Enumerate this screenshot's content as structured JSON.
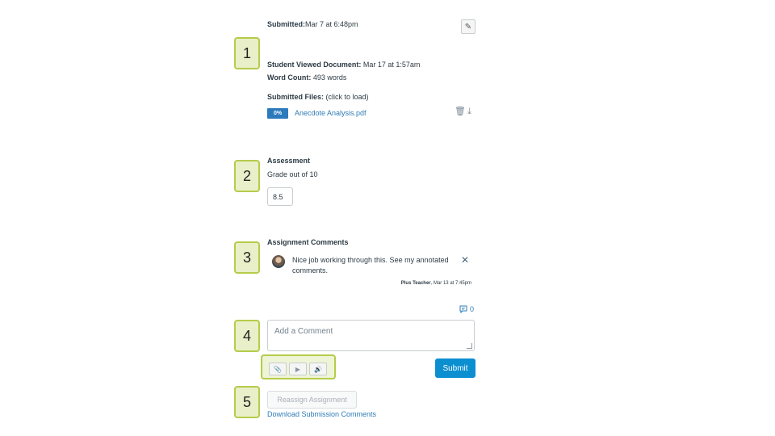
{
  "callouts": [
    "1",
    "2",
    "3",
    "4",
    "5"
  ],
  "submission": {
    "submitted_label": "Submitted:",
    "submitted_value": "Mar 7 at 6:48pm",
    "viewed_label": "Student Viewed Document:",
    "viewed_value": " Mar 17 at 1:57am",
    "word_count_label": "Word Count:",
    "word_count_value": " 493 words",
    "files_label": "Submitted Files:",
    "files_hint": " (click to load)",
    "file": {
      "progress": "0%",
      "name": "Anecdote Analysis.pdf"
    }
  },
  "assessment": {
    "heading": "Assessment",
    "grade_prefix": "Grade out of ",
    "grade_max": "10",
    "grade_value": "8.5"
  },
  "comments": {
    "heading": "Assignment Comments",
    "items": [
      {
        "text": "Nice job working through this. See my annotated comments.",
        "author": "Plus Teacher",
        "date": ", Mar 13 at 7:45pm"
      }
    ],
    "count": "0",
    "placeholder": "Add a Comment",
    "submit_label": "Submit"
  },
  "actions": {
    "reassign_label": "Reassign Assignment",
    "download_label": "Download Submission Comments"
  },
  "icons": [
    "pencil-icon",
    "trash-icon",
    "download-icon",
    "comment-icon",
    "close-icon",
    "attach-icon",
    "video-icon",
    "audio-icon"
  ],
  "colors": {
    "accent": "#0b8fd1",
    "link": "#2d7cb7",
    "callout_border": "#b5cc4b",
    "callout_fill": "#e9f0c9",
    "badge": "#2b7abc"
  }
}
